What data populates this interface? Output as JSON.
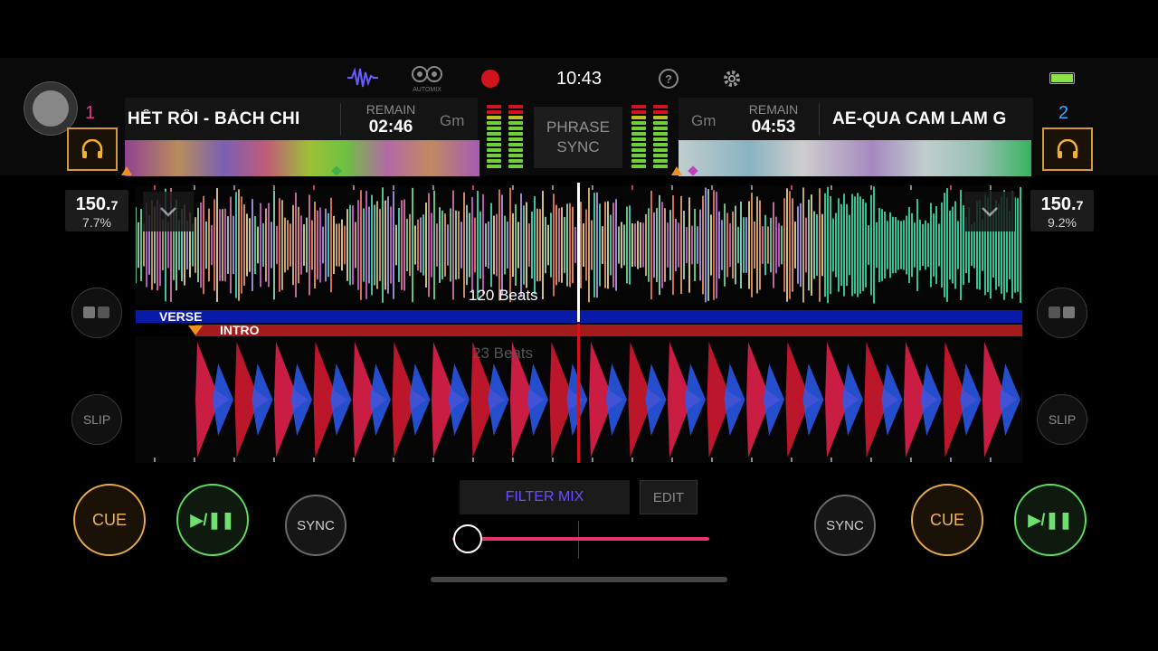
{
  "status": {
    "time": "10:43",
    "automix_label": "AUTOMIX",
    "battery_color": "#8de04a"
  },
  "deck1": {
    "number": "1",
    "number_color": "#e23a8a",
    "title": "HẾT RỒI - BÁCH CHI",
    "remain_label": "REMAIN",
    "remain": "02:46",
    "key": "Gm",
    "bpm_main": "150.",
    "bpm_dec": "7",
    "pitch": "7.7%",
    "cue": "CUE",
    "play": "▶/❚❚",
    "sync": "SYNC",
    "slip": "SLIP"
  },
  "deck2": {
    "number": "2",
    "number_color": "#3aa9ff",
    "title": "AE-QUA CAM LAM G",
    "remain_label": "REMAIN",
    "remain": "04:53",
    "key": "Gm",
    "bpm_main": "150.",
    "bpm_dec": "7",
    "pitch": "9.2%",
    "cue": "CUE",
    "play": "▶/❚❚",
    "sync": "SYNC",
    "slip": "SLIP"
  },
  "phrase_sync": {
    "line1": "PHRASE",
    "line2": "SYNC"
  },
  "waveform": {
    "beats_a": "120 Beats",
    "beats_b": "23 Beats",
    "phrase_a": "VERSE",
    "phrase_b": "INTRO",
    "phrase_a_color": "#0a1aa8",
    "phrase_b_color": "#a51a1a"
  },
  "mixer": {
    "filter_mix": "FILTER MIX",
    "edit": "EDIT",
    "crossfader": 0.06,
    "fader_color": "#e8326e"
  }
}
